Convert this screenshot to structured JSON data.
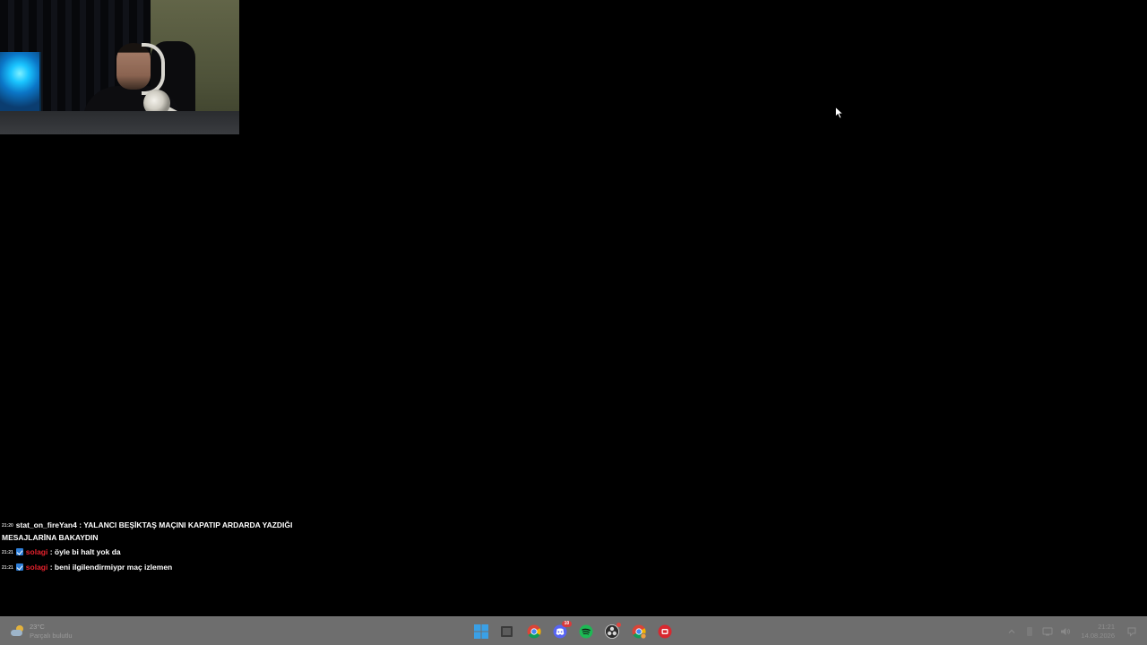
{
  "webcam": {
    "label": "Streamer webcam overlay"
  },
  "chat": {
    "messages": [
      {
        "time": "21:20",
        "user": "stat_on_fireYan4",
        "badge": false,
        "separator": " : ",
        "text": "YALANCI BEŞİKTAŞ MAÇINI KAPATIP ARDARDA YAZDIĞI MESAJLARİNA BAKAYDIN"
      },
      {
        "time": "21:21",
        "user": "solagi",
        "badge": true,
        "separator": " : ",
        "text": "öyle bi halt yok da"
      },
      {
        "time": "21:21",
        "user": "solagi",
        "badge": true,
        "separator": " : ",
        "text": "beni ilgilendirmiypr maç izlemen"
      }
    ],
    "colors": {
      "text": "#ffffff",
      "user_red": "#e8222e",
      "badge": "#2f7fd8"
    }
  },
  "taskbar": {
    "background": "#6e6e6e",
    "weather": {
      "temperature": "23°C",
      "condition": "Parçalı bulutlu"
    },
    "apps": [
      {
        "name": "start-button",
        "icon": "windows-icon",
        "active": false
      },
      {
        "name": "taskview-button",
        "icon": "taskview-icon",
        "active": false
      },
      {
        "name": "chrome-app",
        "icon": "chrome-icon",
        "active": false
      },
      {
        "name": "discord-app",
        "icon": "discord-icon",
        "badge": "10"
      },
      {
        "name": "spotify-app",
        "icon": "spotify-icon",
        "active": false
      },
      {
        "name": "obs-app",
        "icon": "obs-icon",
        "dot": true
      },
      {
        "name": "chrome-profile-app",
        "icon": "chrome-icon",
        "active": false
      },
      {
        "name": "red-app",
        "icon": "red-app-icon",
        "active": false
      }
    ],
    "clock": {
      "time": "21:21",
      "date": "14.08.2026"
    }
  }
}
